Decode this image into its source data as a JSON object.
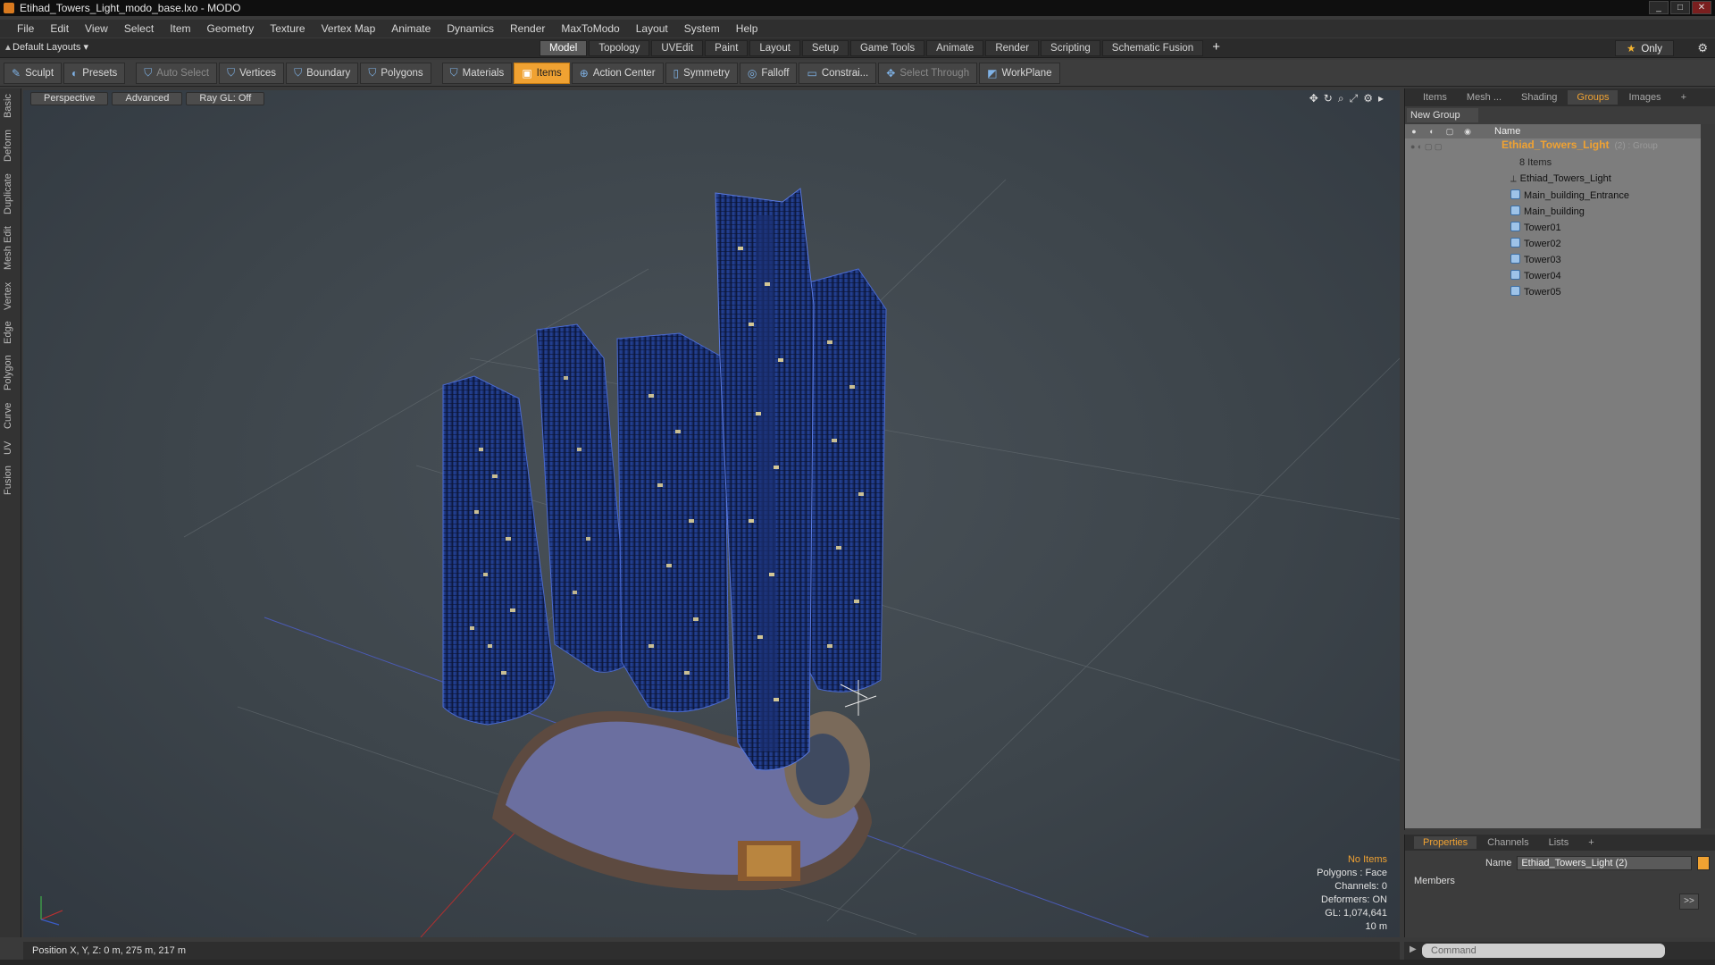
{
  "window": {
    "title": "Etihad_Towers_Light_modo_base.lxo - MODO"
  },
  "menu": [
    "File",
    "Edit",
    "View",
    "Select",
    "Item",
    "Geometry",
    "Texture",
    "Vertex Map",
    "Animate",
    "Dynamics",
    "Render",
    "MaxToModo",
    "Layout",
    "System",
    "Help"
  ],
  "layouts": {
    "dropdown": "Default Layouts ▾",
    "only": "Only"
  },
  "layout_tabs": [
    "Model",
    "Topology",
    "UVEdit",
    "Paint",
    "Layout",
    "Setup",
    "Game Tools",
    "Animate",
    "Render",
    "Scripting",
    "Schematic Fusion"
  ],
  "toolbar": {
    "sculpt": "Sculpt",
    "presets": "Presets",
    "auto_select": "Auto Select",
    "vertices": "Vertices",
    "boundary": "Boundary",
    "polygons": "Polygons",
    "materials": "Materials",
    "items": "Items",
    "action_center": "Action Center",
    "symmetry": "Symmetry",
    "falloff": "Falloff",
    "constraints": "Constrai...",
    "select_through": "Select Through",
    "workplane": "WorkPlane"
  },
  "left_tabs": [
    "Basic",
    "Deform",
    "Duplicate",
    "Mesh Edit",
    "Vertex",
    "Edge",
    "Polygon",
    "Curve",
    "UV",
    "Fusion"
  ],
  "viewport": {
    "view": "Perspective",
    "shading": "Advanced",
    "raygl": "Ray GL: Off",
    "info": {
      "selection": "No Items",
      "polygons": "Polygons : Face",
      "channels": "Channels: 0",
      "deformers": "Deformers: ON",
      "gl": "GL: 1,074,641",
      "scale": "10 m"
    }
  },
  "right_tabs": [
    "Items",
    "Mesh ...",
    "Shading",
    "Groups",
    "Images"
  ],
  "groups": {
    "new_group": "New Group",
    "name_col": "Name",
    "group_name": "Ethiad_Towers_Light",
    "group_suffix": "(2) : Group",
    "item_count": "8 Items",
    "items": [
      "Ethiad_Towers_Light",
      "Main_building_Entrance",
      "Main_building",
      "Tower01",
      "Tower02",
      "Tower03",
      "Tower04",
      "Tower05"
    ]
  },
  "properties": {
    "tabs": [
      "Properties",
      "Channels",
      "Lists"
    ],
    "name_label": "Name",
    "name_value": "Ethiad_Towers_Light (2)",
    "members": "Members",
    "more": ">>"
  },
  "command": {
    "placeholder": "Command"
  },
  "status": {
    "position": "Position X, Y, Z:   0 m, 275 m, 217 m"
  },
  "colors": {
    "accent": "#f0a232",
    "tower": "#1f3a7a",
    "viewport_bg": "#434b52"
  }
}
